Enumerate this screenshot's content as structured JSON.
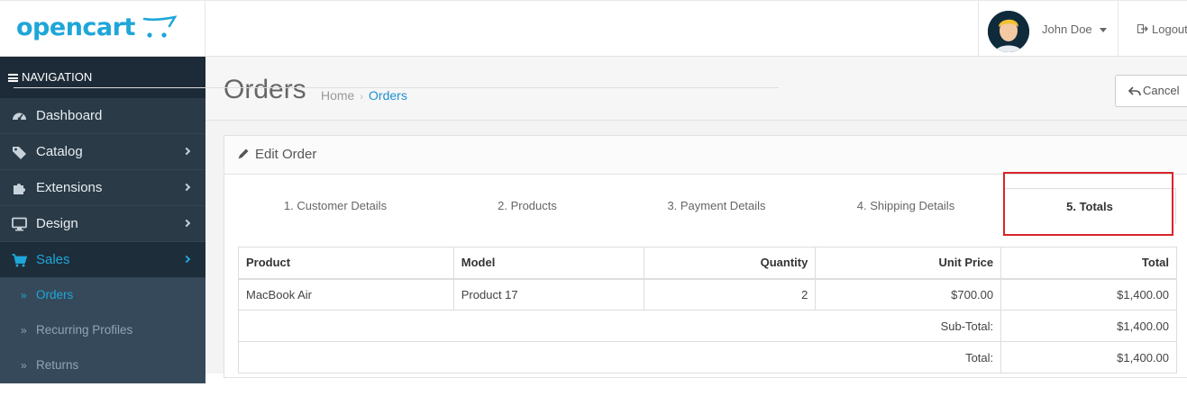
{
  "header": {
    "logo_text": "opencart",
    "user_name": "John Doe",
    "logout_label": "Logout"
  },
  "sidebar": {
    "heading": "NAVIGATION",
    "items": [
      {
        "label": "Dashboard",
        "icon": "dashboard-icon"
      },
      {
        "label": "Catalog",
        "icon": "tags-icon"
      },
      {
        "label": "Extensions",
        "icon": "puzzle-icon"
      },
      {
        "label": "Design",
        "icon": "desktop-icon"
      },
      {
        "label": "Sales",
        "icon": "cart-icon"
      }
    ],
    "sub_items": [
      {
        "label": "Orders"
      },
      {
        "label": "Recurring Profiles"
      },
      {
        "label": "Returns"
      }
    ]
  },
  "page": {
    "title": "Orders",
    "breadcrumb": [
      "Home",
      "Orders"
    ],
    "cancel_label": "Cancel"
  },
  "panel": {
    "heading": "Edit Order",
    "tabs": [
      "1. Customer Details",
      "2. Products",
      "3. Payment Details",
      "4. Shipping Details",
      "5. Totals"
    ],
    "active_tab": "5. Totals"
  },
  "table": {
    "headers": [
      "Product",
      "Model",
      "Quantity",
      "Unit Price",
      "Total"
    ],
    "rows": [
      {
        "product": "MacBook Air",
        "model": "Product 17",
        "quantity": "2",
        "unit_price": "$700.00",
        "total": "$1,400.00"
      }
    ],
    "totals": [
      {
        "label": "Sub-Total:",
        "value": "$1,400.00"
      },
      {
        "label": "Total:",
        "value": "$1,400.00"
      }
    ]
  },
  "colors": {
    "brand": "#1ea6d8",
    "sidebar_bg": "#2b3a47",
    "highlight": "#d9242b"
  }
}
